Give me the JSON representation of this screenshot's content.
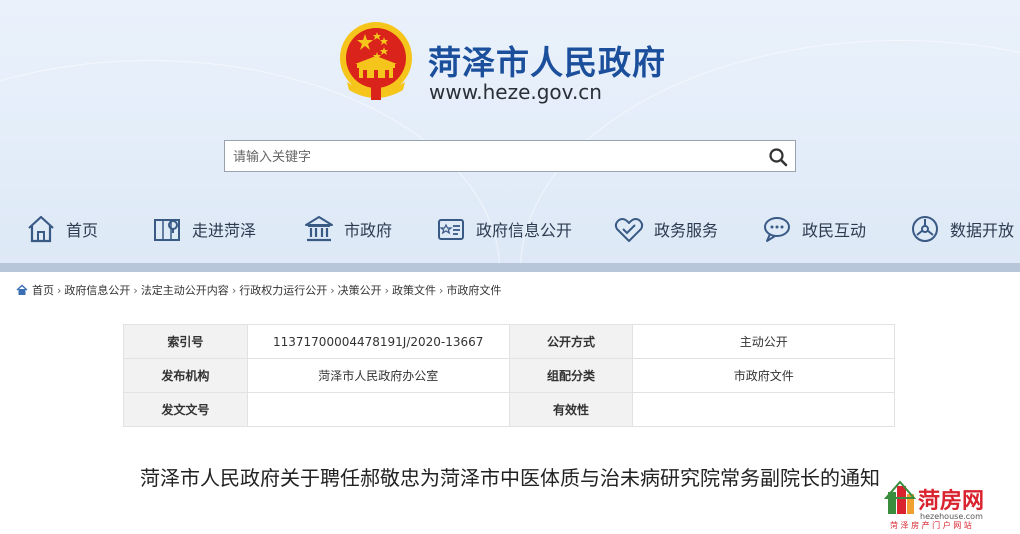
{
  "site": {
    "title": "菏泽市人民政府",
    "url": "www.heze.gov.cn"
  },
  "search": {
    "placeholder": "请输入关键字"
  },
  "nav": {
    "items": [
      {
        "label": "首页",
        "icon": "home-icon"
      },
      {
        "label": "走进菏泽",
        "icon": "map-icon"
      },
      {
        "label": "市政府",
        "icon": "government-building-icon"
      },
      {
        "label": "政府信息公开",
        "icon": "info-public-icon"
      },
      {
        "label": "政务服务",
        "icon": "handshake-icon"
      },
      {
        "label": "政民互动",
        "icon": "chat-icon"
      },
      {
        "label": "数据开放",
        "icon": "data-open-icon"
      }
    ]
  },
  "breadcrumb": {
    "items": [
      "首页",
      "政府信息公开",
      "法定主动公开内容",
      "行政权力运行公开",
      "决策公开",
      "政策文件",
      "市政府文件"
    ],
    "separator": "›"
  },
  "info": {
    "rows": [
      {
        "l1": "索引号",
        "v1": "11371700004478191J/2020-13667",
        "l2": "公开方式",
        "v2": "主动公开"
      },
      {
        "l1": "发布机构",
        "v1": "菏泽市人民政府办公室",
        "l2": "组配分类",
        "v2": "市政府文件"
      },
      {
        "l1": "发文文号",
        "v1": "",
        "l2": "有效性",
        "v2": ""
      }
    ]
  },
  "document": {
    "title": "菏泽市人民政府关于聘任郝敬忠为菏泽市中医体质与治未病研究院常务副院长的通知"
  },
  "watermark": {
    "name": "菏房网",
    "domain": "hezehouse.com",
    "tagline": "菏 泽 房 产 门 户 网 站"
  },
  "colors": {
    "brand_blue": "#1b4f9c",
    "header_bg": "#e3edf9",
    "emblem_red": "#d9231b",
    "emblem_gold": "#f5c51c",
    "watermark_red": "#d9232e",
    "watermark_green": "#3b8d3e"
  }
}
